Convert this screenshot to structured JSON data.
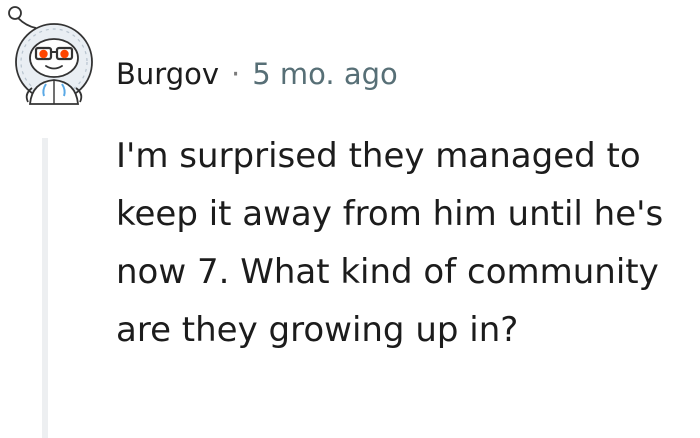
{
  "comment": {
    "author": "Burgov",
    "separator": "·",
    "timestamp": "5 mo. ago",
    "body": "I'm surprised they managed to keep it away from him until he's now 7. What kind of community are they growing up in?"
  },
  "icons": {
    "avatar": "snoo-avatar-with-glasses-and-parka-icon",
    "thread_line": "thread-collapse-line"
  },
  "colors": {
    "text": "#1c1c1c",
    "meta": "#576f76",
    "thread_line": "#edeff1",
    "avatar_glasses": "#ff4500",
    "avatar_hood": "#dde8f2"
  }
}
